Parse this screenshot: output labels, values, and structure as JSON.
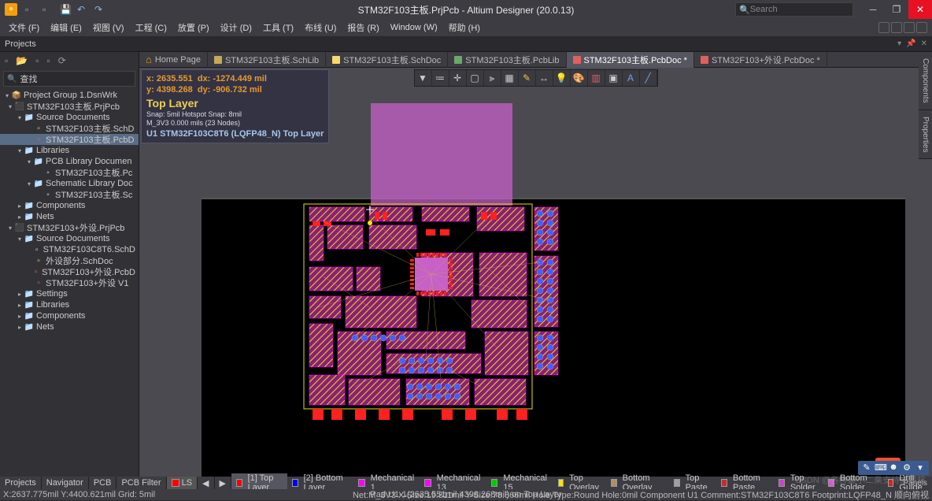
{
  "title": "STM32F103主板.PrjPcb - Altium Designer (20.0.13)",
  "search_placeholder": "Search",
  "menu": [
    "文件 (F)",
    "编辑 (E)",
    "视图 (V)",
    "工程 (C)",
    "放置 (P)",
    "设计 (D)",
    "工具 (T)",
    "布线 (U)",
    "报告 (R)",
    "Window (W)",
    "帮助 (H)"
  ],
  "panel_title": "Projects",
  "sb_search": "查找",
  "tree": [
    {
      "lv": 0,
      "ico": "wrk",
      "arrw": "▾",
      "label": "Project Group 1.DsnWrk"
    },
    {
      "lv": 1,
      "ico": "prj",
      "arrw": "▾",
      "label": "STM32F103主板.PrjPcb"
    },
    {
      "lv": 2,
      "ico": "fldr",
      "arrw": "▾",
      "label": "Source Documents"
    },
    {
      "lv": 3,
      "ico": "sch",
      "arrw": "",
      "label": "STM32F103主板.SchD"
    },
    {
      "lv": 3,
      "ico": "pcb",
      "arrw": "",
      "label": "STM32F103主板.PcbD",
      "sel": true
    },
    {
      "lv": 2,
      "ico": "fldr",
      "arrw": "▾",
      "label": "Libraries"
    },
    {
      "lv": 3,
      "ico": "fldr",
      "arrw": "▾",
      "label": "PCB Library Documen"
    },
    {
      "lv": 4,
      "ico": "lib",
      "arrw": "",
      "label": "STM32F103主板.Pc"
    },
    {
      "lv": 3,
      "ico": "fldr",
      "arrw": "▾",
      "label": "Schematic Library Doc"
    },
    {
      "lv": 4,
      "ico": "lib",
      "arrw": "",
      "label": "STM32F103主板.Sc"
    },
    {
      "lv": 2,
      "ico": "fldr",
      "arrw": "▸",
      "label": "Components"
    },
    {
      "lv": 2,
      "ico": "fldr",
      "arrw": "▸",
      "label": "Nets"
    },
    {
      "lv": 1,
      "ico": "prj",
      "arrw": "▾",
      "label": "STM32F103+外设.PrjPcb"
    },
    {
      "lv": 2,
      "ico": "fldr",
      "arrw": "▾",
      "label": "Source Documents"
    },
    {
      "lv": 3,
      "ico": "sch",
      "arrw": "",
      "label": "STM32F103C8T6.SchD"
    },
    {
      "lv": 3,
      "ico": "sch",
      "arrw": "",
      "label": "外设部分.SchDoc"
    },
    {
      "lv": 3,
      "ico": "pcb",
      "arrw": "",
      "label": "STM32F103+外设.PcbD"
    },
    {
      "lv": 3,
      "ico": "pcb",
      "arrw": "",
      "label": "STM32F103+外设 V1"
    },
    {
      "lv": 2,
      "ico": "fldr",
      "arrw": "▸",
      "label": "Settings"
    },
    {
      "lv": 2,
      "ico": "fldr",
      "arrw": "▸",
      "label": "Libraries"
    },
    {
      "lv": 2,
      "ico": "fldr",
      "arrw": "▸",
      "label": "Components"
    },
    {
      "lv": 2,
      "ico": "fldr",
      "arrw": "▸",
      "label": "Nets"
    }
  ],
  "doc_tabs": [
    {
      "label": "Home Page",
      "home": true
    },
    {
      "label": "STM32F103主板.SchLib",
      "color": "#c7a85a"
    },
    {
      "label": "STM32F103主板.SchDoc",
      "color": "#f7d968"
    },
    {
      "label": "STM32F103主板.PcbLib",
      "color": "#6aa96a"
    },
    {
      "label": "STM32F103主板.PcbDoc *",
      "color": "#e06060",
      "active": true
    },
    {
      "label": "STM32F103+外设.PcbDoc *",
      "color": "#e06060"
    }
  ],
  "hud": {
    "x": "x: 2635.551",
    "dx": "dx: -1274.449 mil",
    "y": "y: 4398.268",
    "dy": "dy:   -906.732  mil",
    "layer": "Top Layer",
    "snap": "Snap: 5mil Hotspot Snap: 8mil",
    "net": "M_3V3       0.000 mils (23 Nodes)",
    "comp": "U1  STM32F103C8T6 (LQFP48_N)  Top Layer"
  },
  "right_panels": [
    "Components",
    "Properties"
  ],
  "bottom_tabs": [
    "Projects",
    "Navigator",
    "PCB",
    "PCB Filter"
  ],
  "layers": [
    {
      "sw": "#ff0000",
      "label": "[1] Top Layer",
      "active": true
    },
    {
      "sw": "#0000ff",
      "label": "[2] Bottom Layer"
    },
    {
      "sw": "#ff00ff",
      "label": "Mechanical 1"
    },
    {
      "sw": "#ff00ff",
      "label": "Mechanical 13"
    },
    {
      "sw": "#00cc00",
      "label": "Mechanical 15"
    },
    {
      "sw": "#ffe000",
      "label": "Top Overlay"
    },
    {
      "sw": "#b09060",
      "label": "Bottom Overlay"
    },
    {
      "sw": "#a0a0a0",
      "label": "Top Paste"
    },
    {
      "sw": "#c03030",
      "label": "Bottom Paste"
    },
    {
      "sw": "#d040d0",
      "label": "Top Solder"
    },
    {
      "sw": "#e050e0",
      "label": "Bottom Solder"
    },
    {
      "sw": "#d02020",
      "label": "Drill Guide"
    }
  ],
  "ls_label": "LS",
  "status_left": "X:2637.775mil Y:4400.621mil    Grid: 5mil",
  "status_mid": "Pad U1-1(2635.551mil,4398.268mil) on Top Layer",
  "status_right": "Net:M_3V3 X-Size:19.811mil Y-Size:78.866mil Hole Type:Round Hole:0mil   Component U1 Comment:STM32F103C8T6 Footprint:LQFP48_N 顺向俯视",
  "panels_btn": "Panels",
  "watermark": "CSDN @各种最小二乘支持向量机",
  "ime": "中"
}
